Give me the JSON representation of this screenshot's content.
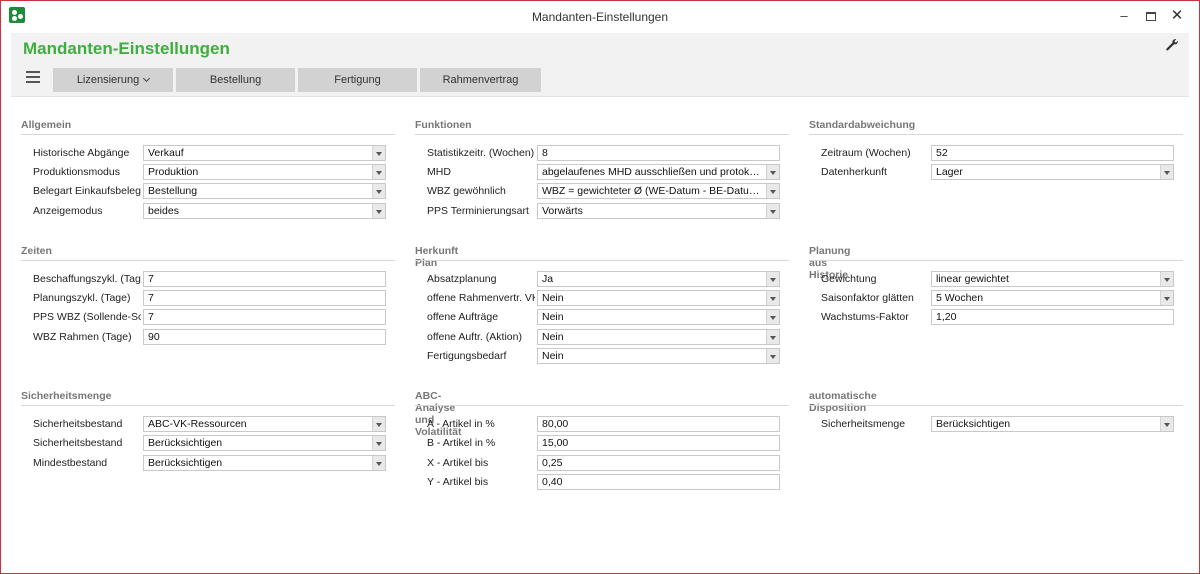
{
  "window": {
    "title": "Mandanten-Einstellungen",
    "minimize": "–",
    "close": "✕"
  },
  "header": {
    "title": "Mandanten-Einstellungen",
    "title_color": "#3eae3f",
    "tabs": [
      {
        "label": "Lizensierung"
      },
      {
        "label": "Bestellung"
      },
      {
        "label": "Fertigung"
      },
      {
        "label": "Rahmenvertrag"
      }
    ]
  },
  "sections": {
    "allgemein": {
      "title": "Allgemein",
      "rows": [
        {
          "label": "Historische Abgänge",
          "value": "Verkauf"
        },
        {
          "label": "Produktionsmodus",
          "value": "Produktion"
        },
        {
          "label": "Belegart Einkaufsbeleg",
          "value": "Bestellung"
        },
        {
          "label": "Anzeigemodus",
          "value": "beides"
        }
      ]
    },
    "funktionen": {
      "title": "Funktionen",
      "rows": [
        {
          "label": "Statistikzeitr. (Wochen)",
          "value": "8"
        },
        {
          "label": "MHD",
          "value": "abgelaufenes MHD ausschließen und protokolli..."
        },
        {
          "label": "WBZ gewöhnlich",
          "value": "WBZ = gewichteter Ø (WE-Datum - BE-Datum)..."
        },
        {
          "label": "PPS Terminierungsart",
          "value": "Vorwärts"
        }
      ]
    },
    "standardabweichung": {
      "title": "Standardabweichung",
      "rows": [
        {
          "label": "Zeitraum (Wochen)",
          "value": "52"
        },
        {
          "label": "Datenherkunft",
          "value": "Lager"
        }
      ]
    },
    "zeiten": {
      "title": "Zeiten",
      "rows": [
        {
          "label": "Beschaffungszykl. (Tage)",
          "value": "7"
        },
        {
          "label": "Planungszykl. (Tage)",
          "value": "7"
        },
        {
          "label": "PPS WBZ (Sollende-Sollst",
          "value": "7"
        },
        {
          "label": "WBZ Rahmen (Tage)",
          "value": "90"
        }
      ]
    },
    "herkunft": {
      "title": "Herkunft Plan",
      "rows": [
        {
          "label": "Absatzplanung",
          "value": "Ja"
        },
        {
          "label": "offene Rahmenvertr. VK",
          "value": "Nein"
        },
        {
          "label": "offene Aufträge",
          "value": "Nein"
        },
        {
          "label": "offene Auftr. (Aktion)",
          "value": "Nein"
        },
        {
          "label": "Fertigungsbedarf",
          "value": "Nein"
        }
      ]
    },
    "planung": {
      "title": "Planung aus Historie",
      "rows": [
        {
          "label": "Gewichtung",
          "value": "linear gewichtet"
        },
        {
          "label": "Saisonfaktor glätten",
          "value": "5 Wochen"
        },
        {
          "label": "Wachstums-Faktor",
          "value": "1,20"
        }
      ]
    },
    "sicherheit": {
      "title": "Sicherheitsmenge",
      "rows": [
        {
          "label": "Sicherheitsbestand",
          "value": "ABC-VK-Ressourcen"
        },
        {
          "label": "Sicherheitsbestand",
          "value": "Berücksichtigen"
        },
        {
          "label": "Mindestbestand",
          "value": "Berücksichtigen"
        }
      ]
    },
    "abc": {
      "title": "ABC-Analyse und Volatilität",
      "rows": [
        {
          "label": "A - Artikel in %",
          "value": "80,00"
        },
        {
          "label": "B - Artikel in %",
          "value": "15,00"
        },
        {
          "label": "X - Artikel bis",
          "value": "0,25"
        },
        {
          "label": "Y - Artikel bis",
          "value": "0,40"
        }
      ]
    },
    "disposition": {
      "title": "automatische Disposition",
      "rows": [
        {
          "label": "Sicherheitsmenge",
          "value": "Berücksichtigen"
        }
      ]
    }
  }
}
